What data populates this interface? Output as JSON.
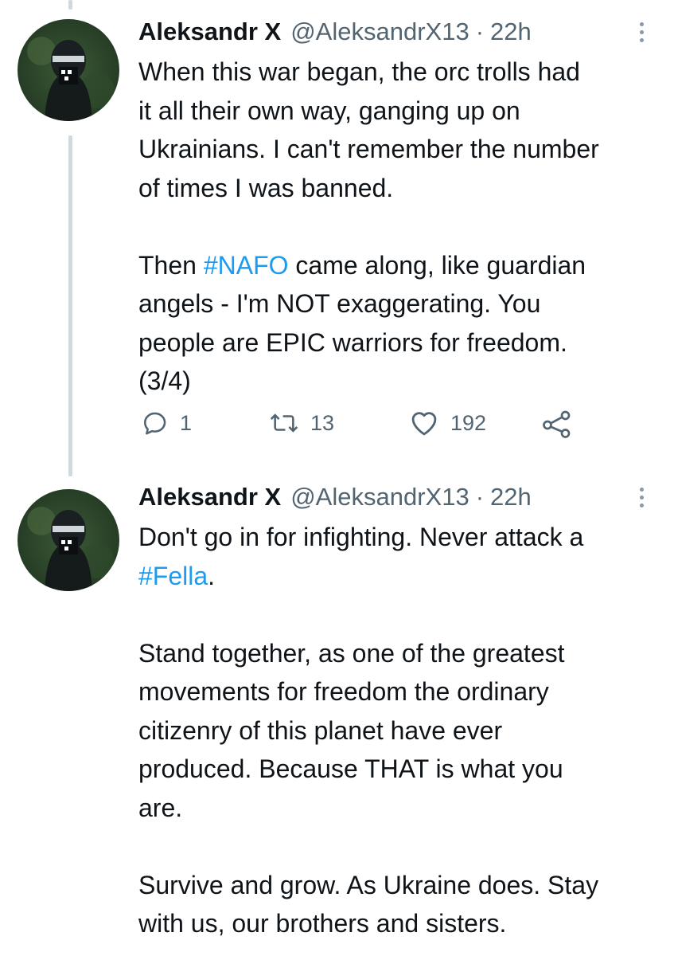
{
  "thread": {
    "tweets": [
      {
        "author_name": "Aleksandr X",
        "handle": "@AleksandrX13",
        "separator": "·",
        "time": "22h",
        "paragraphs": [
          [
            "When this war began, the orc trolls had",
            "it all their own way, ganging up on",
            "Ukrainians. I can't remember the number",
            "of times I was banned."
          ],
          [
            "Then ",
            "#NAFO",
            " came along, like guardian",
            "angels - I'm NOT exaggerating. You",
            "people are EPIC warriors for freedom.",
            "(3/4)"
          ]
        ],
        "actions": {
          "replies": "1",
          "retweets": "13",
          "likes": "192"
        },
        "icons": [
          "reply-icon",
          "retweet-icon",
          "like-icon",
          "share-icon"
        ]
      },
      {
        "author_name": "Aleksandr X",
        "handle": "@AleksandrX13",
        "separator": "·",
        "time": "22h",
        "paragraphs": [
          [
            "Don't go in for infighting. Never attack a",
            "#Fella",
            "."
          ],
          [
            "Stand together, as one of the greatest",
            "movements for freedom the ordinary",
            "citizenry of this planet have ever",
            "produced. Because THAT is what you",
            "are."
          ],
          [
            "Survive and grow. As Ukraine does. Stay",
            "with us, our brothers and sisters."
          ]
        ]
      }
    ]
  },
  "colors": {
    "link": "#1d9bf0",
    "secondary_text": "#536471",
    "primary_text": "#0f1419",
    "thread_line": "#cfd9de"
  }
}
